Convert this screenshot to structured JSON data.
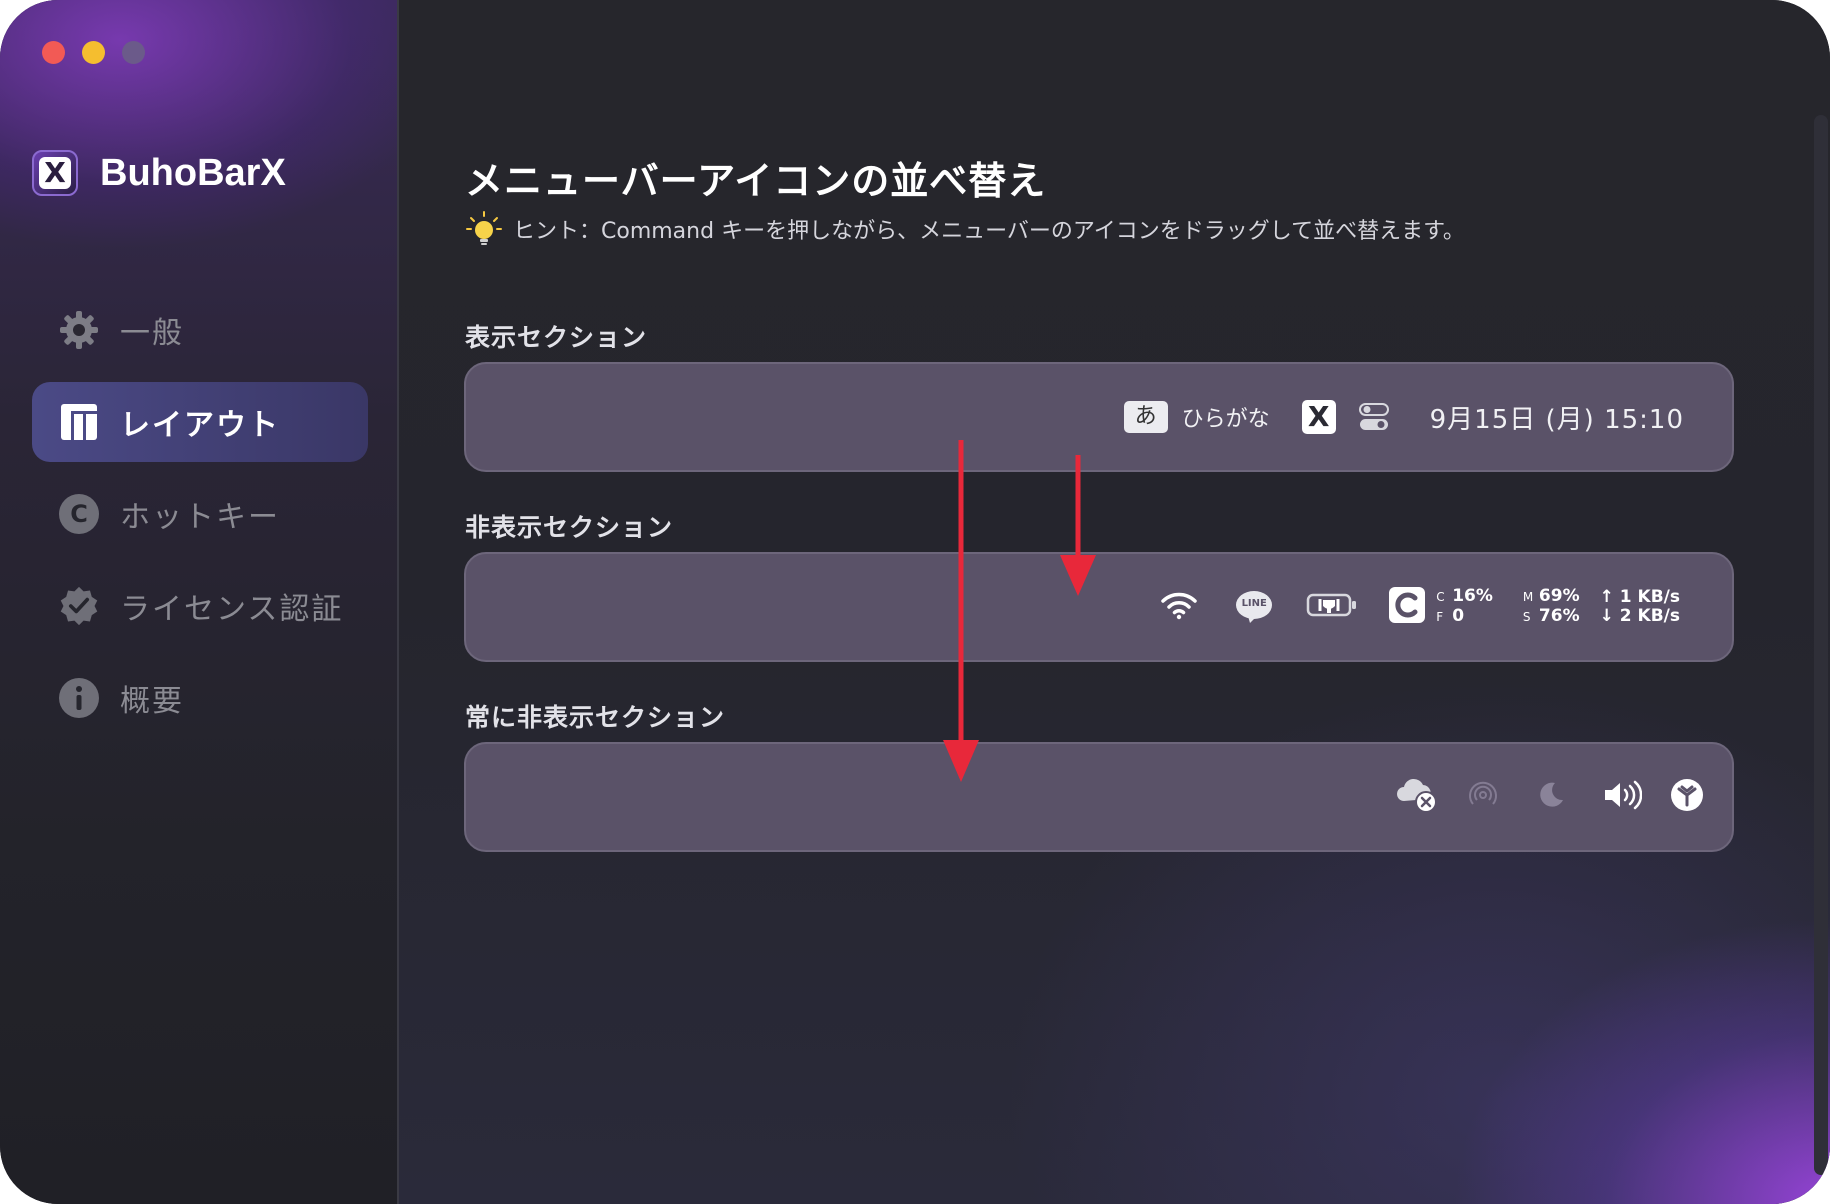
{
  "window": {
    "traffic_lights": [
      "close",
      "minimize",
      "maximize"
    ]
  },
  "sidebar": {
    "app_name": "BuhoBarX",
    "logo_letter": "X",
    "items": [
      {
        "label": "一般",
        "icon": "gear-icon",
        "active": false
      },
      {
        "label": "レイアウト",
        "icon": "layout-icon",
        "active": true
      },
      {
        "label": "ホットキー",
        "icon": "hotkey-c-icon",
        "active": false
      },
      {
        "label": "ライセンス認証",
        "icon": "verified-badge-icon",
        "active": false
      },
      {
        "label": "概要",
        "icon": "info-icon",
        "active": false
      }
    ]
  },
  "main": {
    "title": "メニューバーアイコンの並べ替え",
    "hint": "ヒント：Command キーを押しながら、メニューバーのアイコンをドラッグして並べ替えます。",
    "sections": {
      "shown": {
        "label": "表示セクション",
        "input_kana": "あ",
        "input_mode": "ひらがな",
        "buhobar_letter": "X",
        "date_time": "9月15日 (月)  15:10"
      },
      "hidden": {
        "label": "非表示セクション",
        "line_text": "LINE",
        "cpu_stats": {
          "c_label": "C",
          "c_value": "16%",
          "f_label": "F",
          "f_value": "0"
        },
        "mem_stats": {
          "m_label": "M",
          "m_value": "69%",
          "s_label": "S",
          "s_value": "76%"
        },
        "net_stats": {
          "up": "↑ 1 KB/s",
          "down": "↓ 2 KB/s"
        }
      },
      "always_hidden": {
        "label": "常に非表示セクション"
      }
    }
  },
  "colors": {
    "accent_arrow": "#e8283a",
    "panel": "#5a5268",
    "nav_active": "#4b4a86"
  }
}
